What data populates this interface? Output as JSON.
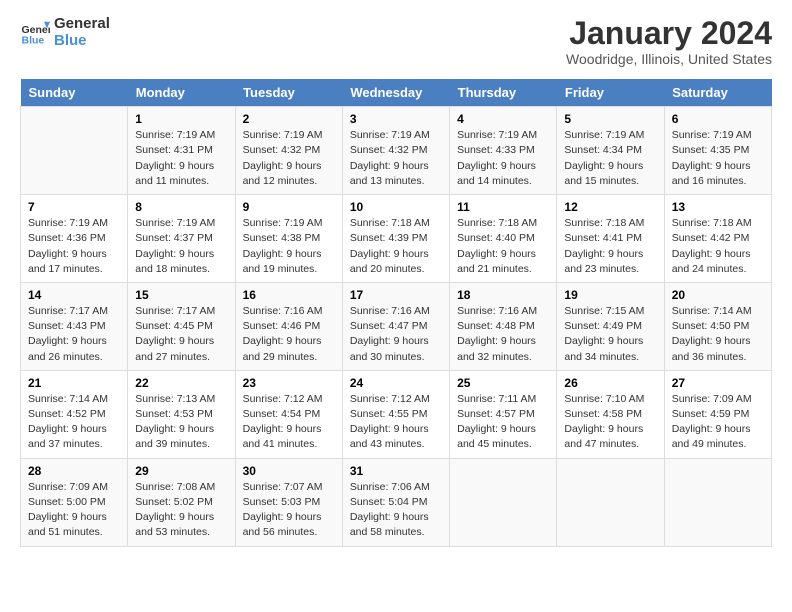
{
  "logo": {
    "line1": "General",
    "line2": "Blue"
  },
  "title": "January 2024",
  "subtitle": "Woodridge, Illinois, United States",
  "days_header": [
    "Sunday",
    "Monday",
    "Tuesday",
    "Wednesday",
    "Thursday",
    "Friday",
    "Saturday"
  ],
  "weeks": [
    [
      {
        "num": "",
        "detail": ""
      },
      {
        "num": "1",
        "detail": "Sunrise: 7:19 AM\nSunset: 4:31 PM\nDaylight: 9 hours\nand 11 minutes."
      },
      {
        "num": "2",
        "detail": "Sunrise: 7:19 AM\nSunset: 4:32 PM\nDaylight: 9 hours\nand 12 minutes."
      },
      {
        "num": "3",
        "detail": "Sunrise: 7:19 AM\nSunset: 4:32 PM\nDaylight: 9 hours\nand 13 minutes."
      },
      {
        "num": "4",
        "detail": "Sunrise: 7:19 AM\nSunset: 4:33 PM\nDaylight: 9 hours\nand 14 minutes."
      },
      {
        "num": "5",
        "detail": "Sunrise: 7:19 AM\nSunset: 4:34 PM\nDaylight: 9 hours\nand 15 minutes."
      },
      {
        "num": "6",
        "detail": "Sunrise: 7:19 AM\nSunset: 4:35 PM\nDaylight: 9 hours\nand 16 minutes."
      }
    ],
    [
      {
        "num": "7",
        "detail": "Sunrise: 7:19 AM\nSunset: 4:36 PM\nDaylight: 9 hours\nand 17 minutes."
      },
      {
        "num": "8",
        "detail": "Sunrise: 7:19 AM\nSunset: 4:37 PM\nDaylight: 9 hours\nand 18 minutes."
      },
      {
        "num": "9",
        "detail": "Sunrise: 7:19 AM\nSunset: 4:38 PM\nDaylight: 9 hours\nand 19 minutes."
      },
      {
        "num": "10",
        "detail": "Sunrise: 7:18 AM\nSunset: 4:39 PM\nDaylight: 9 hours\nand 20 minutes."
      },
      {
        "num": "11",
        "detail": "Sunrise: 7:18 AM\nSunset: 4:40 PM\nDaylight: 9 hours\nand 21 minutes."
      },
      {
        "num": "12",
        "detail": "Sunrise: 7:18 AM\nSunset: 4:41 PM\nDaylight: 9 hours\nand 23 minutes."
      },
      {
        "num": "13",
        "detail": "Sunrise: 7:18 AM\nSunset: 4:42 PM\nDaylight: 9 hours\nand 24 minutes."
      }
    ],
    [
      {
        "num": "14",
        "detail": "Sunrise: 7:17 AM\nSunset: 4:43 PM\nDaylight: 9 hours\nand 26 minutes."
      },
      {
        "num": "15",
        "detail": "Sunrise: 7:17 AM\nSunset: 4:45 PM\nDaylight: 9 hours\nand 27 minutes."
      },
      {
        "num": "16",
        "detail": "Sunrise: 7:16 AM\nSunset: 4:46 PM\nDaylight: 9 hours\nand 29 minutes."
      },
      {
        "num": "17",
        "detail": "Sunrise: 7:16 AM\nSunset: 4:47 PM\nDaylight: 9 hours\nand 30 minutes."
      },
      {
        "num": "18",
        "detail": "Sunrise: 7:16 AM\nSunset: 4:48 PM\nDaylight: 9 hours\nand 32 minutes."
      },
      {
        "num": "19",
        "detail": "Sunrise: 7:15 AM\nSunset: 4:49 PM\nDaylight: 9 hours\nand 34 minutes."
      },
      {
        "num": "20",
        "detail": "Sunrise: 7:14 AM\nSunset: 4:50 PM\nDaylight: 9 hours\nand 36 minutes."
      }
    ],
    [
      {
        "num": "21",
        "detail": "Sunrise: 7:14 AM\nSunset: 4:52 PM\nDaylight: 9 hours\nand 37 minutes."
      },
      {
        "num": "22",
        "detail": "Sunrise: 7:13 AM\nSunset: 4:53 PM\nDaylight: 9 hours\nand 39 minutes."
      },
      {
        "num": "23",
        "detail": "Sunrise: 7:12 AM\nSunset: 4:54 PM\nDaylight: 9 hours\nand 41 minutes."
      },
      {
        "num": "24",
        "detail": "Sunrise: 7:12 AM\nSunset: 4:55 PM\nDaylight: 9 hours\nand 43 minutes."
      },
      {
        "num": "25",
        "detail": "Sunrise: 7:11 AM\nSunset: 4:57 PM\nDaylight: 9 hours\nand 45 minutes."
      },
      {
        "num": "26",
        "detail": "Sunrise: 7:10 AM\nSunset: 4:58 PM\nDaylight: 9 hours\nand 47 minutes."
      },
      {
        "num": "27",
        "detail": "Sunrise: 7:09 AM\nSunset: 4:59 PM\nDaylight: 9 hours\nand 49 minutes."
      }
    ],
    [
      {
        "num": "28",
        "detail": "Sunrise: 7:09 AM\nSunset: 5:00 PM\nDaylight: 9 hours\nand 51 minutes."
      },
      {
        "num": "29",
        "detail": "Sunrise: 7:08 AM\nSunset: 5:02 PM\nDaylight: 9 hours\nand 53 minutes."
      },
      {
        "num": "30",
        "detail": "Sunrise: 7:07 AM\nSunset: 5:03 PM\nDaylight: 9 hours\nand 56 minutes."
      },
      {
        "num": "31",
        "detail": "Sunrise: 7:06 AM\nSunset: 5:04 PM\nDaylight: 9 hours\nand 58 minutes."
      },
      {
        "num": "",
        "detail": ""
      },
      {
        "num": "",
        "detail": ""
      },
      {
        "num": "",
        "detail": ""
      }
    ]
  ]
}
